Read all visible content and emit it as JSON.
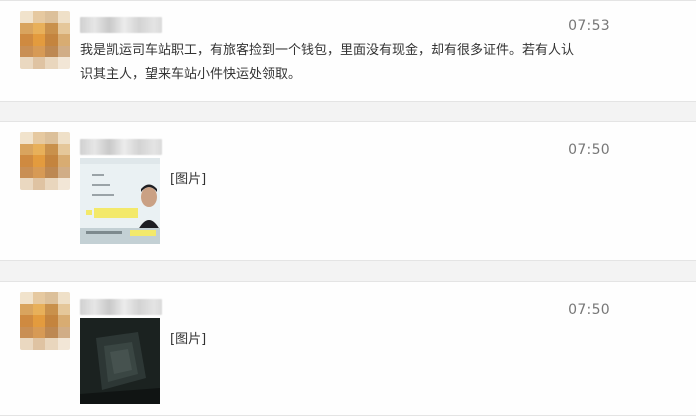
{
  "posts": [
    {
      "time": "07:53",
      "text": "我是凯运司车站职工，有旅客捡到一个钱包，里面没有现金，却有很多证件。若有人认识其主人，望来车站小件快运处领取。"
    },
    {
      "time": "07:50",
      "image_label": "[图片]",
      "image_icon": "id-card-photo"
    },
    {
      "time": "07:50",
      "image_label": "[图片]",
      "image_icon": "dark-wallet-photo"
    }
  ]
}
